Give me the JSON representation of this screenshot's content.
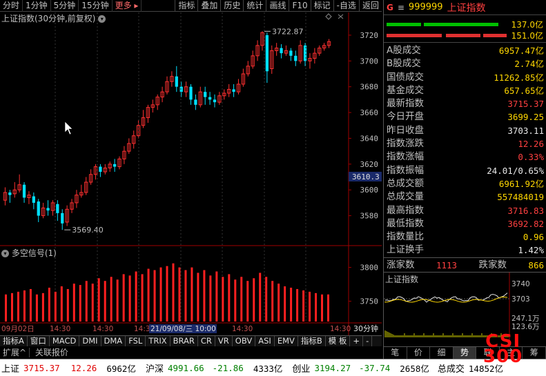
{
  "toolbar": {
    "periods": [
      "分时",
      "1分钟",
      "5分钟",
      "15分钟"
    ],
    "more": "更多",
    "tools": [
      "指标",
      "叠加",
      "历史",
      "统计",
      "画线",
      "F10",
      "标记",
      "-自选",
      "返回"
    ]
  },
  "chart": {
    "title": "上证指数(30分钟,前复权)",
    "high_label": "3722.87",
    "low_label": "3569.40",
    "current_price_tag": "3610.3",
    "y_ticks": [
      "3720",
      "3700",
      "3680",
      "3660",
      "3640",
      "3620",
      "3600",
      "3580"
    ],
    "x_labels": [
      "09月02日",
      "14:30",
      "14:30",
      "14:30",
      "21/09/08/三 10:00",
      "14:30",
      "14:30"
    ],
    "period_label": "30分钟"
  },
  "volume": {
    "title": "多空信号(1)",
    "y_ticks": [
      "3800",
      "3750"
    ]
  },
  "bottom_tabs": [
    "指标A",
    "窗口",
    "MACD",
    "DMI",
    "DMA",
    "FSL",
    "TRIX",
    "BRAR",
    "CR",
    "VR",
    "OBV",
    "ASI",
    "EMV",
    "指标B",
    "模 板",
    "+",
    "-"
  ],
  "panel": {
    "g": "G",
    "eq": "≡",
    "code": "999999",
    "name": "上证指数",
    "bar1": "137.0亿",
    "bar2": "151.0亿",
    "rows": [
      {
        "label": "A股成交",
        "value": "6957.47亿",
        "color": "yel"
      },
      {
        "label": "B股成交",
        "value": "2.74亿",
        "color": "yel"
      },
      {
        "label": "国债成交",
        "value": "11262.85亿",
        "color": "yel"
      },
      {
        "label": "基金成交",
        "value": "657.65亿",
        "color": "yel"
      },
      {
        "label": "最新指数",
        "value": "3715.37",
        "color": "red"
      },
      {
        "label": "今日开盘",
        "value": "3699.25",
        "color": "yel"
      },
      {
        "label": "昨日收盘",
        "value": "3703.11",
        "color": "white"
      },
      {
        "label": "指数涨跌",
        "value": "12.26",
        "color": "red"
      },
      {
        "label": "指数涨幅",
        "value": "0.33%",
        "color": "red"
      },
      {
        "label": "指数振幅",
        "value": "24.01/0.65%",
        "color": "white"
      },
      {
        "label": "总成交额",
        "value": "6961.92亿",
        "color": "yel"
      },
      {
        "label": "总成交量",
        "value": "557484019",
        "color": "yel"
      },
      {
        "label": "最高指数",
        "value": "3716.83",
        "color": "red"
      },
      {
        "label": "最低指数",
        "value": "3692.82",
        "color": "red"
      },
      {
        "label": "指数量比",
        "value": "0.96",
        "color": "yel"
      },
      {
        "label": "上证换手",
        "value": "1.42%",
        "color": "white"
      }
    ],
    "up_label": "涨家数",
    "up_value": "1113",
    "down_label": "跌家数",
    "down_value": "866",
    "mini_title": "上证指数",
    "mini_ticks": [
      "3740",
      "3703",
      "247.1万",
      "123.6万"
    ],
    "tabs": [
      "笔",
      "价",
      "细",
      "势",
      "联",
      "主",
      "筹"
    ]
  },
  "ticker": {
    "sh_label": "上证",
    "sh_price": "3715.37",
    "sh_change": "12.26",
    "sh_amount": "6962亿",
    "hs_label": "沪深",
    "hs_price": "4991.66",
    "hs_change": "-21.86",
    "hs_amount": "4333亿",
    "cy_label": "创业",
    "cy_price": "3194.27",
    "cy_change": "-37.74",
    "cy_amount": "2658亿",
    "total_label": "总成交",
    "total_value": "14852亿"
  },
  "status": {
    "expand": "扩展^",
    "quote": "关联报价"
  },
  "logo": {
    "line1": "CSI",
    "line2": "300"
  },
  "colors": {
    "up": "#ff3030",
    "down": "#00e0ff",
    "bg": "#000000",
    "accent": "#ffd700"
  },
  "chart_data": {
    "type": "candlestick",
    "candles": [
      {
        "o": 3592,
        "c": 3598,
        "h": 3602,
        "l": 3588
      },
      {
        "o": 3598,
        "c": 3596,
        "h": 3600,
        "l": 3590
      },
      {
        "o": 3597,
        "c": 3600,
        "h": 3606,
        "l": 3594
      },
      {
        "o": 3600,
        "c": 3604,
        "h": 3612,
        "l": 3598
      },
      {
        "o": 3604,
        "c": 3594,
        "h": 3606,
        "l": 3590
      },
      {
        "o": 3594,
        "c": 3596,
        "h": 3599,
        "l": 3589
      },
      {
        "o": 3595,
        "c": 3590,
        "h": 3598,
        "l": 3585
      },
      {
        "o": 3591,
        "c": 3580,
        "h": 3593,
        "l": 3575
      },
      {
        "o": 3580,
        "c": 3586,
        "h": 3590,
        "l": 3578
      },
      {
        "o": 3586,
        "c": 3584,
        "h": 3592,
        "l": 3580
      },
      {
        "o": 3584,
        "c": 3590,
        "h": 3592,
        "l": 3580
      },
      {
        "o": 3589,
        "c": 3582,
        "h": 3592,
        "l": 3576
      },
      {
        "o": 3582,
        "c": 3574,
        "h": 3585,
        "l": 3569
      },
      {
        "o": 3575,
        "c": 3585,
        "h": 3588,
        "l": 3572
      },
      {
        "o": 3585,
        "c": 3590,
        "h": 3593,
        "l": 3582
      },
      {
        "o": 3590,
        "c": 3596,
        "h": 3600,
        "l": 3586
      },
      {
        "o": 3596,
        "c": 3598,
        "h": 3604,
        "l": 3594
      },
      {
        "o": 3598,
        "c": 3606,
        "h": 3610,
        "l": 3596
      },
      {
        "o": 3606,
        "c": 3612,
        "h": 3616,
        "l": 3604
      },
      {
        "o": 3612,
        "c": 3618,
        "h": 3620,
        "l": 3608
      },
      {
        "o": 3618,
        "c": 3614,
        "h": 3620,
        "l": 3610
      },
      {
        "o": 3614,
        "c": 3617,
        "h": 3620,
        "l": 3612
      },
      {
        "o": 3617,
        "c": 3620,
        "h": 3622,
        "l": 3614
      },
      {
        "o": 3620,
        "c": 3618,
        "h": 3624,
        "l": 3614
      },
      {
        "o": 3618,
        "c": 3624,
        "h": 3626,
        "l": 3616
      },
      {
        "o": 3624,
        "c": 3630,
        "h": 3634,
        "l": 3620
      },
      {
        "o": 3630,
        "c": 3636,
        "h": 3640,
        "l": 3628
      },
      {
        "o": 3636,
        "c": 3642,
        "h": 3646,
        "l": 3632
      },
      {
        "o": 3642,
        "c": 3650,
        "h": 3654,
        "l": 3640
      },
      {
        "o": 3650,
        "c": 3656,
        "h": 3662,
        "l": 3648
      },
      {
        "o": 3656,
        "c": 3664,
        "h": 3666,
        "l": 3652
      },
      {
        "o": 3664,
        "c": 3666,
        "h": 3670,
        "l": 3660
      },
      {
        "o": 3666,
        "c": 3672,
        "h": 3674,
        "l": 3662
      },
      {
        "o": 3672,
        "c": 3676,
        "h": 3680,
        "l": 3668
      },
      {
        "o": 3676,
        "c": 3684,
        "h": 3688,
        "l": 3674
      },
      {
        "o": 3684,
        "c": 3688,
        "h": 3692,
        "l": 3680
      },
      {
        "o": 3688,
        "c": 3680,
        "h": 3696,
        "l": 3676
      },
      {
        "o": 3680,
        "c": 3676,
        "h": 3684,
        "l": 3672
      },
      {
        "o": 3676,
        "c": 3680,
        "h": 3684,
        "l": 3672
      },
      {
        "o": 3680,
        "c": 3670,
        "h": 3682,
        "l": 3666
      },
      {
        "o": 3670,
        "c": 3666,
        "h": 3674,
        "l": 3662
      },
      {
        "o": 3666,
        "c": 3676,
        "h": 3680,
        "l": 3664
      },
      {
        "o": 3676,
        "c": 3672,
        "h": 3680,
        "l": 3666
      },
      {
        "o": 3672,
        "c": 3670,
        "h": 3676,
        "l": 3666
      },
      {
        "o": 3670,
        "c": 3668,
        "h": 3674,
        "l": 3664
      },
      {
        "o": 3668,
        "c": 3673,
        "h": 3676,
        "l": 3666
      },
      {
        "o": 3673,
        "c": 3675,
        "h": 3678,
        "l": 3670
      },
      {
        "o": 3675,
        "c": 3678,
        "h": 3682,
        "l": 3672
      },
      {
        "o": 3678,
        "c": 3676,
        "h": 3682,
        "l": 3672
      },
      {
        "o": 3676,
        "c": 3682,
        "h": 3686,
        "l": 3674
      },
      {
        "o": 3682,
        "c": 3690,
        "h": 3694,
        "l": 3680
      },
      {
        "o": 3690,
        "c": 3696,
        "h": 3700,
        "l": 3688
      },
      {
        "o": 3696,
        "c": 3704,
        "h": 3708,
        "l": 3694
      },
      {
        "o": 3704,
        "c": 3712,
        "h": 3716,
        "l": 3700
      },
      {
        "o": 3712,
        "c": 3722,
        "h": 3723,
        "l": 3708
      },
      {
        "o": 3720,
        "c": 3692,
        "h": 3722,
        "l": 3683
      },
      {
        "o": 3694,
        "c": 3708,
        "h": 3712,
        "l": 3690
      },
      {
        "o": 3708,
        "c": 3710,
        "h": 3714,
        "l": 3704
      },
      {
        "o": 3710,
        "c": 3706,
        "h": 3713,
        "l": 3702
      },
      {
        "o": 3706,
        "c": 3708,
        "h": 3712,
        "l": 3704
      },
      {
        "o": 3708,
        "c": 3704,
        "h": 3710,
        "l": 3700
      },
      {
        "o": 3704,
        "c": 3700,
        "h": 3708,
        "l": 3696
      },
      {
        "o": 3700,
        "c": 3712,
        "h": 3716,
        "l": 3698
      },
      {
        "o": 3712,
        "c": 3700,
        "h": 3714,
        "l": 3696
      },
      {
        "o": 3700,
        "c": 3702,
        "h": 3706,
        "l": 3694
      },
      {
        "o": 3702,
        "c": 3706,
        "h": 3710,
        "l": 3698
      },
      {
        "o": 3706,
        "c": 3710,
        "h": 3712,
        "l": 3704
      },
      {
        "o": 3710,
        "c": 3712,
        "h": 3714,
        "l": 3708
      },
      {
        "o": 3712,
        "c": 3715,
        "h": 3717,
        "l": 3710
      }
    ],
    "signal_values": [
      3760,
      3762,
      3764,
      3766,
      3768,
      3760,
      3762,
      3770,
      3764,
      3772,
      3768,
      3776,
      3774,
      3780,
      3776,
      3784,
      3780,
      3786,
      3782,
      3790,
      3788,
      3794,
      3790,
      3798,
      3796,
      3800,
      3802,
      3806,
      3800,
      3796,
      3800,
      3792,
      3796,
      3788,
      3794,
      3786,
      3790,
      3782,
      3786,
      3780,
      3784,
      3792,
      3786,
      3780,
      3776,
      3772,
      3770,
      3768,
      3766,
      3764,
      3762,
      3760,
      3760
    ],
    "ylim": [
      3560,
      3728
    ]
  }
}
